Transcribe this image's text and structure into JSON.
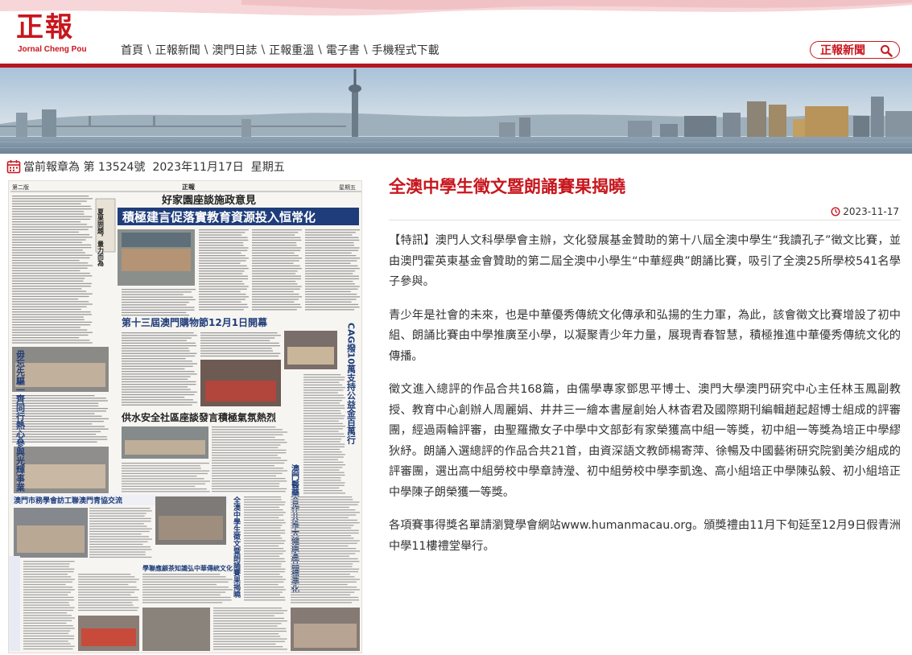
{
  "logo": {
    "main_text": "正報",
    "sub_text": "Jornal Cheng Pou"
  },
  "nav": {
    "items": [
      {
        "label": "首頁"
      },
      {
        "label": "正報新聞"
      },
      {
        "label": "澳門日誌"
      },
      {
        "label": "正報重溫"
      },
      {
        "label": "電子書"
      },
      {
        "label": "手機程式下載"
      }
    ],
    "separator": "\\"
  },
  "search": {
    "label": "正報新聞",
    "icon": "search-icon"
  },
  "issue": {
    "prefix": "當前報章為 第 13524號",
    "date": "2023年11月17日",
    "weekday": "星期五",
    "icon": "calendar-icon"
  },
  "newspaper": {
    "masthead_left": "第二版",
    "masthead_center": "正報",
    "masthead_right": "星期五",
    "headlines": {
      "top_kicker": "好家園座談施政意見",
      "top_main": "積極建言促落實教育資源投入恒常化",
      "shopping": "第十三屆澳門購物節12月1日開幕",
      "water": "供水安全社區座談發言積極氣氛熱烈",
      "commerce": "澳門市務學會訪工聯澳門青協交流",
      "school": "學聯應顧茶知識弘中華傳統文化",
      "vertical_left": "毋忘先驅一齊同行熱心參與光輝事業",
      "vertical_right_top": "CAG撥10萬支持公益金百萬行",
      "vertical_right_mid": "澳門醫藥合作共推大健康產品標準化",
      "vertical_right_bottom": "全澳中學生徵文暨朗誦賽果揭曉",
      "side_box": "夏果問題，量力而為"
    }
  },
  "article": {
    "title": "全澳中學生徵文暨朗誦賽果揭曉",
    "date": "2023-11-17",
    "paragraphs": [
      "【特訊】澳門人文科學學會主辦，文化發展基金贊助的第十八屆全澳中學生“我讀孔子”徵文比賽，並由澳門霍英東基金會贊助的第二屆全澳中小學生“中華經典”朗誦比賽，吸引了全澳25所學校541名學子參與。",
      "青少年是社會的未來，也是中華優秀傳統文化傳承和弘揚的生力軍，為此，該會徵文比賽增設了初中組、朗誦比賽由中學推廣至小學，以凝聚青少年力量，展現青春智慧，積極推進中華優秀傳統文化的傳播。",
      "徵文進入總評的作品合共168篇，由儒學專家鄧思平博士、澳門大學澳門研究中心主任林玉鳳副教授、教育中心創辦人周麗娟、井井三一繪本書屋創始人林杳君及國際期刊編輯趙起超博士組成的評審團，經過兩輪評審，由聖羅撒女子中學中文部彭有家榮獲高中組一等獎，初中組一等獎為培正中學繆狄紓。朗誦入選總評的作品合共21首，由資深語文教師楊寄萍、徐暢及中國藝術研究院劉美汐組成的評審團，選出高中組勞校中學章詩瀅、初中組勞校中學李凱逸、高小組培正中學陳弘毅、初小組培正中學陳子朗榮獲一等獎。",
      "各項賽事得獎名單請瀏覽學會網站www.humanmacau.org。頒獎禮由11月下旬延至12月9日假青洲中學11樓禮堂舉行。"
    ]
  },
  "colors": {
    "brand_red": "#c8161d",
    "bar_red": "#b5171f",
    "text": "#333333"
  }
}
